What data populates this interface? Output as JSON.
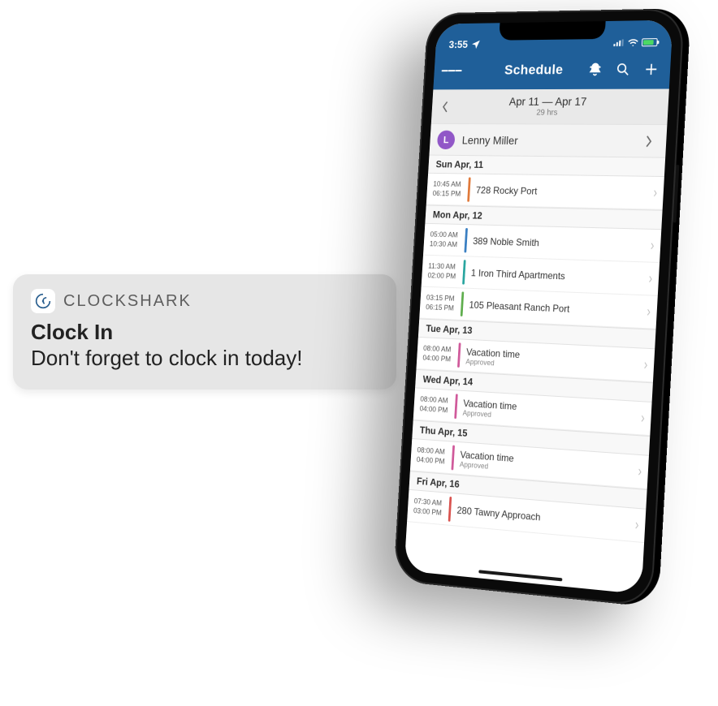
{
  "notification": {
    "app_name": "CLOCKSHARK",
    "title": "Clock In",
    "body": "Don't forget to clock in today!"
  },
  "statusbar": {
    "time": "3:55"
  },
  "navbar": {
    "title": "Schedule"
  },
  "range": {
    "dates": "Apr 11 — Apr 17",
    "hours": "29 hrs"
  },
  "employee": {
    "initial": "L",
    "name": "Lenny Miller"
  },
  "colors": {
    "orange": "#e07a3b",
    "blue": "#3a7fc2",
    "teal": "#2aa6a0",
    "green": "#5fae4e",
    "pink": "#d05a9b",
    "red": "#d9534f"
  },
  "schedule": [
    {
      "day": "Sun Apr, 11",
      "shifts": [
        {
          "start": "10:45 AM",
          "end": "06:15 PM",
          "title": "728 Rocky Port",
          "sub": "",
          "color": "orange"
        }
      ]
    },
    {
      "day": "Mon Apr, 12",
      "shifts": [
        {
          "start": "05:00 AM",
          "end": "10:30 AM",
          "title": "389 Noble Smith",
          "sub": "",
          "color": "blue"
        },
        {
          "start": "11:30 AM",
          "end": "02:00 PM",
          "title": "1 Iron Third Apartments",
          "sub": "",
          "color": "teal"
        },
        {
          "start": "03:15 PM",
          "end": "06:15 PM",
          "title": "105 Pleasant Ranch Port",
          "sub": "",
          "color": "green"
        }
      ]
    },
    {
      "day": "Tue Apr, 13",
      "shifts": [
        {
          "start": "08:00 AM",
          "end": "04:00 PM",
          "title": "Vacation time",
          "sub": "Approved",
          "color": "pink"
        }
      ]
    },
    {
      "day": "Wed Apr, 14",
      "shifts": [
        {
          "start": "08:00 AM",
          "end": "04:00 PM",
          "title": "Vacation time",
          "sub": "Approved",
          "color": "pink"
        }
      ]
    },
    {
      "day": "Thu Apr, 15",
      "shifts": [
        {
          "start": "08:00 AM",
          "end": "04:00 PM",
          "title": "Vacation time",
          "sub": "Approved",
          "color": "pink"
        }
      ]
    },
    {
      "day": "Fri Apr, 16",
      "shifts": [
        {
          "start": "07:30 AM",
          "end": "03:00 PM",
          "title": "280 Tawny Approach",
          "sub": "",
          "color": "red"
        }
      ]
    }
  ]
}
